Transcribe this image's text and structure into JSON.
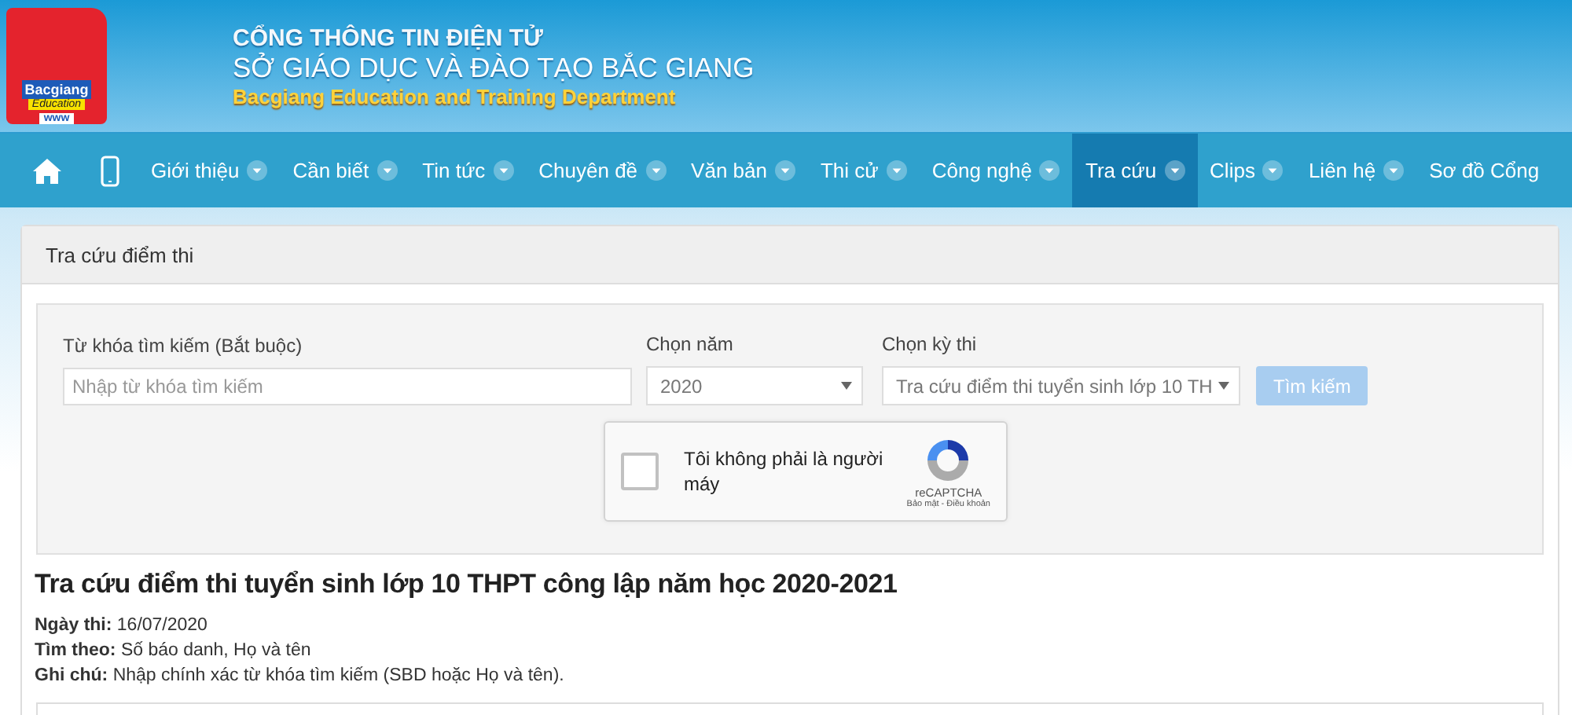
{
  "header": {
    "logo": {
      "text": "Bacgiang",
      "subtext": "Education",
      "footer": "www"
    },
    "line1": "CỔNG THÔNG TIN ĐIỆN TỬ",
    "line2": "SỞ GIÁO DỤC VÀ ĐÀO TẠO BẮC GIANG",
    "line3": "Bacgiang Education and Training Department"
  },
  "nav": [
    {
      "kind": "home",
      "selected": false
    },
    {
      "kind": "mobile",
      "selected": false
    },
    {
      "kind": "link",
      "label": "Giới thiệu",
      "has_dropdown": true,
      "selected": false
    },
    {
      "kind": "link",
      "label": "Cần biết",
      "has_dropdown": true,
      "selected": false
    },
    {
      "kind": "link",
      "label": "Tin tức",
      "has_dropdown": true,
      "selected": false
    },
    {
      "kind": "link",
      "label": "Chuyên đề",
      "has_dropdown": true,
      "selected": false
    },
    {
      "kind": "link",
      "label": "Văn bản",
      "has_dropdown": true,
      "selected": false
    },
    {
      "kind": "link",
      "label": "Thi cử",
      "has_dropdown": true,
      "selected": false
    },
    {
      "kind": "link",
      "label": "Công nghệ",
      "has_dropdown": true,
      "selected": false
    },
    {
      "kind": "link",
      "label": "Tra cứu",
      "has_dropdown": true,
      "selected": true
    },
    {
      "kind": "link",
      "label": "Clips",
      "has_dropdown": true,
      "selected": false
    },
    {
      "kind": "link",
      "label": "Liên hệ",
      "has_dropdown": true,
      "selected": false
    },
    {
      "kind": "link",
      "label": "Sơ đồ Cổng",
      "has_dropdown": false,
      "selected": false
    }
  ],
  "panel": {
    "title": "Tra cứu điểm thi",
    "form": {
      "keyword": {
        "label": "Từ khóa tìm kiếm (Bắt buộc)",
        "placeholder": "Nhập từ khóa tìm kiếm"
      },
      "year": {
        "label": "Chọn năm",
        "value": "2020"
      },
      "exam": {
        "label": "Chọn kỳ thi",
        "value": "Tra cứu điểm thi tuyển sinh lớp 10 TH"
      },
      "search_button": {
        "label": "Tìm kiếm",
        "disabled": true
      },
      "captcha": {
        "label": "Tôi không phải là người máy",
        "checked": false,
        "brand": "reCAPTCHA",
        "links": "Bảo mật - Điều khoản"
      }
    },
    "result_title": "Tra cứu điểm thi tuyển sinh lớp 10 THPT công lập năm học 2020-2021",
    "info": [
      "**Ngày thi:** 16/07/2020",
      "**Tìm theo:** Số báo danh, Họ và tên",
      "**Ghi chú:** Nhập chính xác từ khóa tìm kiếm (SBD hoặc Họ và tên)."
    ]
  }
}
